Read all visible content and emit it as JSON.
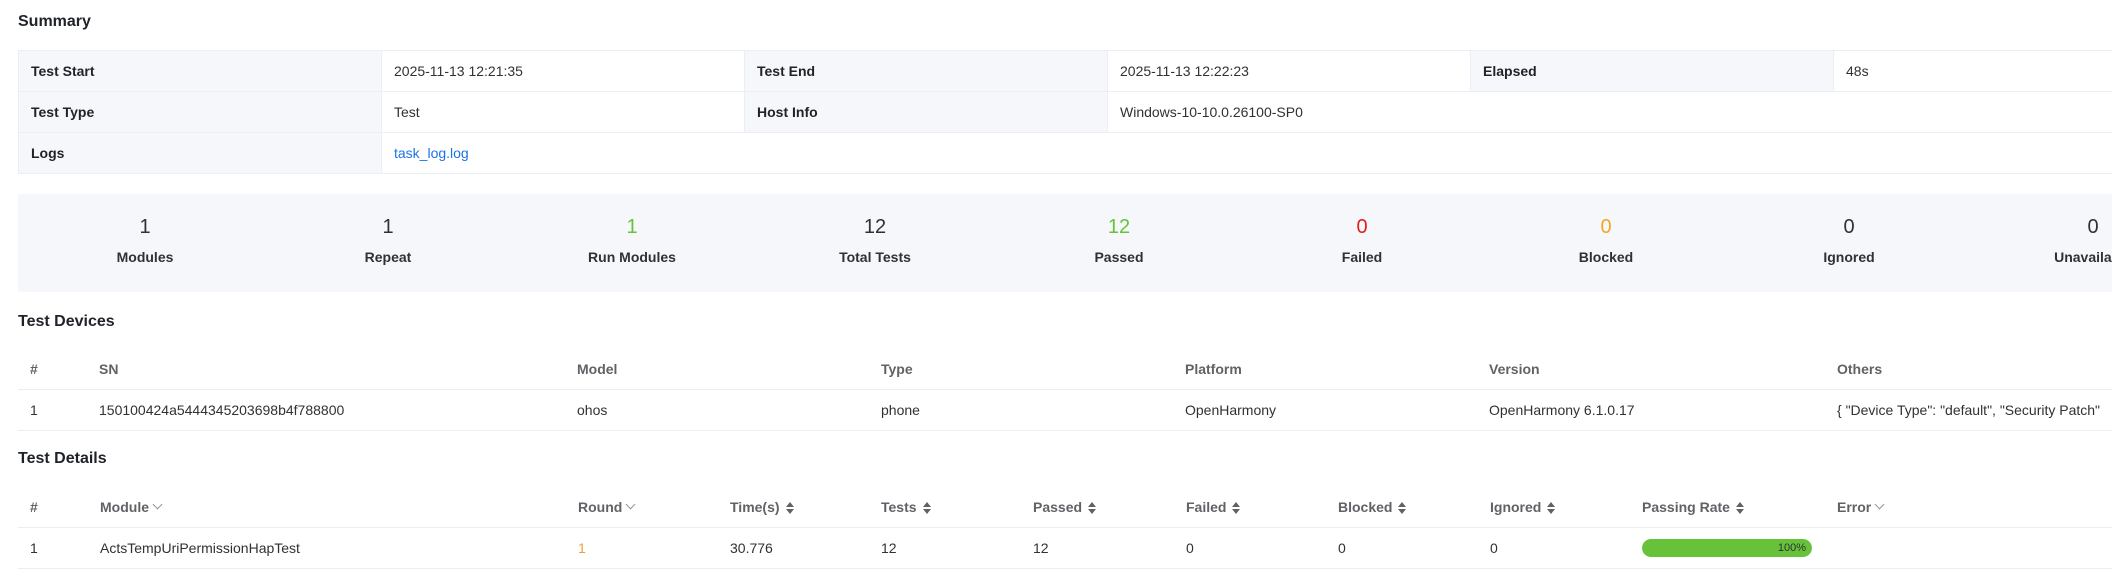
{
  "summary": {
    "title": "Summary",
    "rows": [
      [
        {
          "k": "Test Start",
          "v": "2025-11-13 12:21:35"
        },
        {
          "k": "Test End",
          "v": "2025-11-13 12:22:23"
        },
        {
          "k": "Elapsed",
          "v": "48s"
        }
      ],
      [
        {
          "k": "Test Type",
          "v": "Test"
        },
        {
          "k": "Host Info",
          "v": "Windows-10-10.0.26100-SP0"
        }
      ],
      [
        {
          "k": "Logs",
          "v": "task_log.log"
        }
      ]
    ]
  },
  "stats": [
    {
      "value": "1",
      "label": "Modules",
      "color": "#303133"
    },
    {
      "value": "1",
      "label": "Repeat",
      "color": "#303133"
    },
    {
      "value": "1",
      "label": "Run Modules",
      "color": "#67c23a"
    },
    {
      "value": "12",
      "label": "Total Tests",
      "color": "#303133"
    },
    {
      "value": "12",
      "label": "Passed",
      "color": "#67c23a"
    },
    {
      "value": "0",
      "label": "Failed",
      "color": "#e02020"
    },
    {
      "value": "0",
      "label": "Blocked",
      "color": "#f5a623"
    },
    {
      "value": "0",
      "label": "Ignored",
      "color": "#303133"
    },
    {
      "value": "0",
      "label": "Unavailable",
      "color": "#303133"
    }
  ],
  "devices": {
    "title": "Test Devices",
    "columns": [
      "#",
      "SN",
      "Model",
      "Type",
      "Platform",
      "Version",
      "Others"
    ],
    "rows": [
      [
        "1",
        "150100424a5444345203698b4f788800",
        "ohos",
        "phone",
        "OpenHarmony",
        "OpenHarmony 6.1.0.17",
        "{ \"Device Type\": \"default\", \"Security Patch\""
      ]
    ]
  },
  "details": {
    "title": "Test Details",
    "columns": [
      "#",
      "Module",
      "Round",
      "Time(s)",
      "Tests",
      "Passed",
      "Failed",
      "Blocked",
      "Ignored",
      "Passing Rate",
      "Error"
    ],
    "rows": [
      {
        "idx": "1",
        "module": "ActsTempUriPermissionHapTest",
        "round": "1",
        "time": "30.776",
        "tests": "12",
        "passed": "12",
        "failed": "0",
        "blocked": "0",
        "ignored": "0",
        "rate_text": "100%",
        "rate": 1.0,
        "error": ""
      }
    ]
  },
  "colors": {
    "accent": "#1a73e8",
    "pass": "#67c23a",
    "fail": "#e02020",
    "warn": "#f5a623"
  }
}
